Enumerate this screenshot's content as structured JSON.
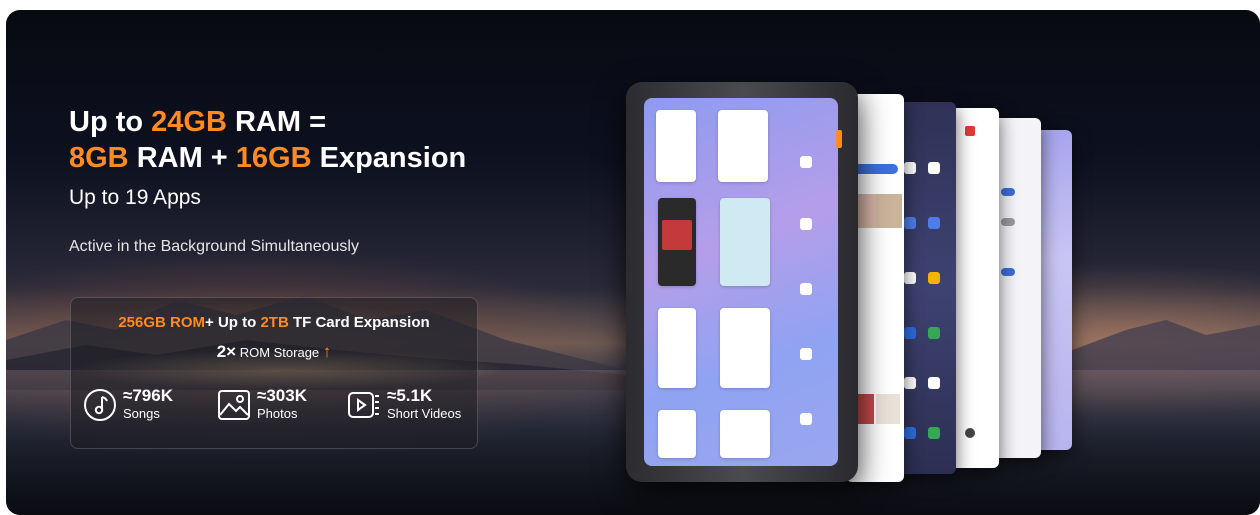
{
  "headline": {
    "line1_prefix": "Up to ",
    "line1_highlight": "24GB",
    "line1_suffix": " RAM =",
    "line2_highlight1": "8GB",
    "line2_middle": " RAM + ",
    "line2_highlight2": "16GB",
    "line2_suffix": " Expansion"
  },
  "subhead": "Up to 19 Apps",
  "subtext": "Active in the Background Simultaneously",
  "storage": {
    "rom_highlight": "256GB ROM",
    "rom_middle": "+ Up to ",
    "tf_highlight": "2TB",
    "tf_suffix": " TF Card Expansion",
    "multiplier": "2×",
    "multiplier_label": " ROM Storage",
    "arrow": "↑",
    "stats": [
      {
        "value": "≈796K",
        "label": "Songs",
        "icon": "music-note-icon"
      },
      {
        "value": "≈303K",
        "label": "Photos",
        "icon": "photo-icon"
      },
      {
        "value": "≈5.1K",
        "label": "Short Videos",
        "icon": "video-icon"
      }
    ]
  },
  "colors": {
    "accent": "#ff8a1f",
    "text": "#ffffff"
  }
}
